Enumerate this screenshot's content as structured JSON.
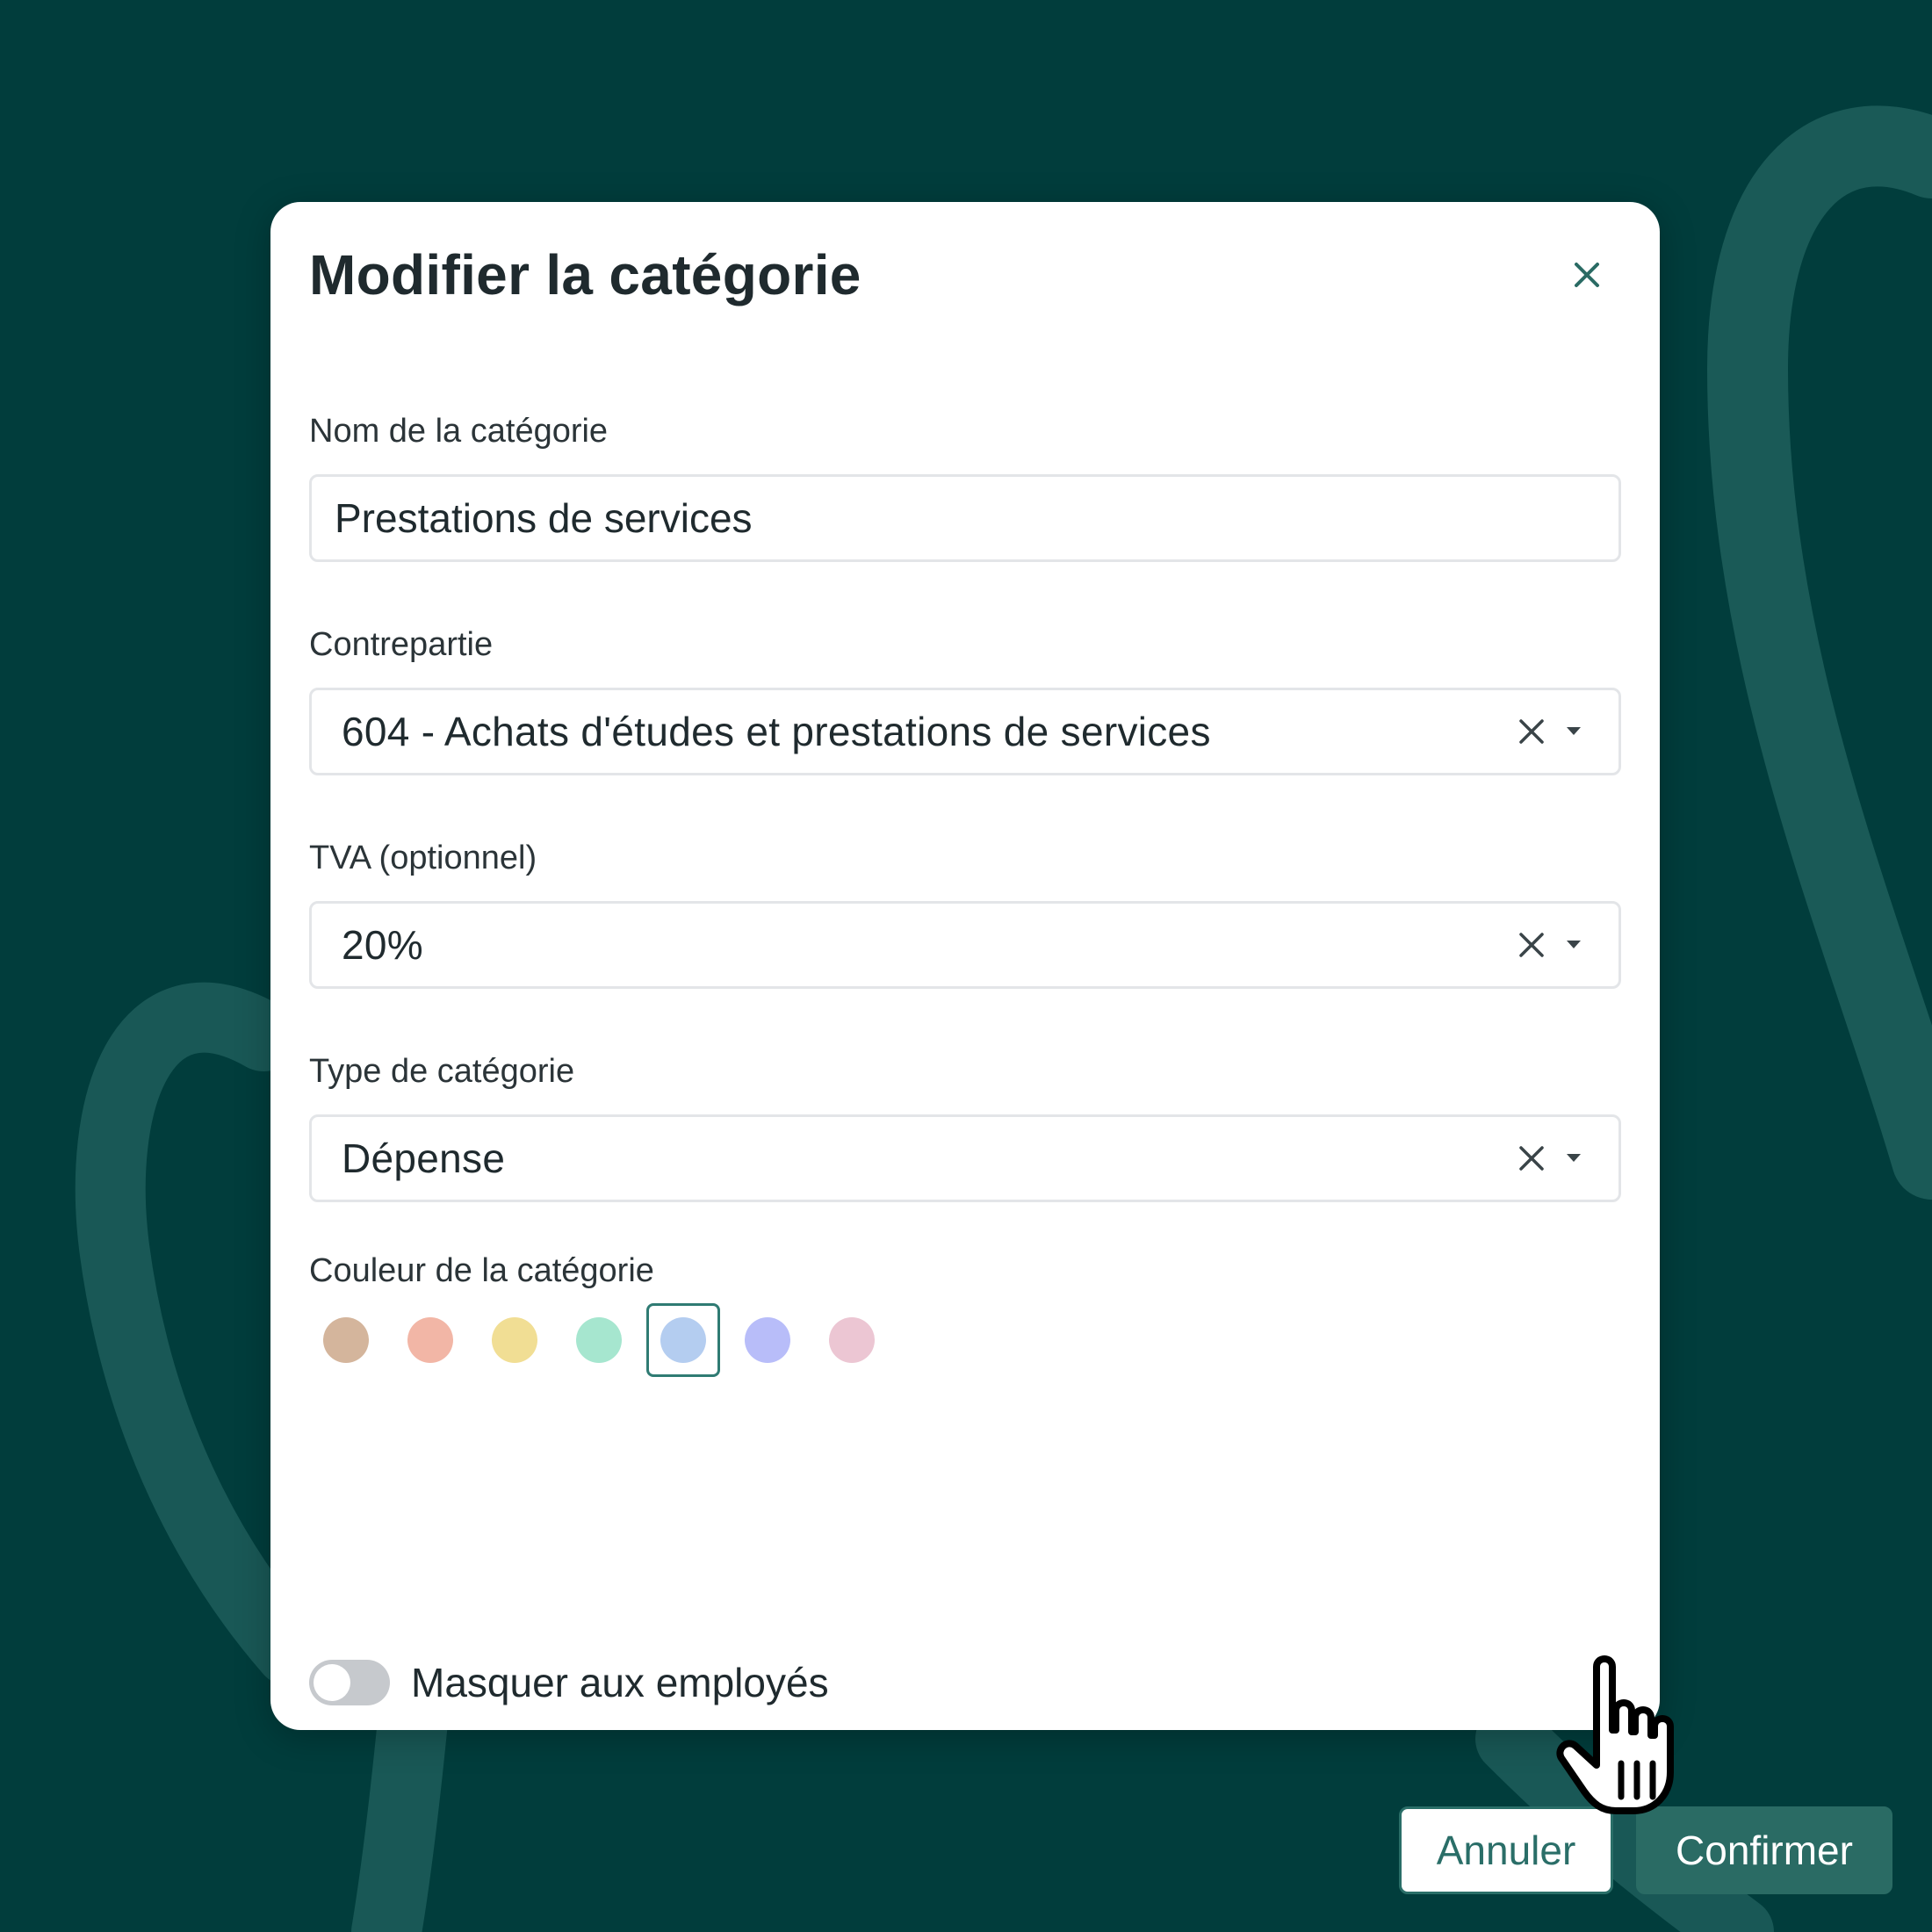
{
  "dialog": {
    "title": "Modifier la catégorie",
    "close_icon": "close-icon"
  },
  "fields": {
    "name": {
      "label": "Nom de la catégorie",
      "value": "Prestations de services"
    },
    "counterpart": {
      "label": "Contrepartie",
      "value": "604 - Achats d'études et prestations de services"
    },
    "vat": {
      "label": "TVA (optionnel)",
      "value": "20%"
    },
    "type": {
      "label": "Type de catégorie",
      "value": "Dépense"
    }
  },
  "color_picker": {
    "label": "Couleur de la catégorie",
    "swatches": [
      "#d4b59c",
      "#f2b6a6",
      "#f1de94",
      "#a6e6cf",
      "#b4cdf0",
      "#b8bdf9",
      "#ecc6d3"
    ],
    "selected_index": 4,
    "selected_border": "#2f7b73"
  },
  "toggle": {
    "label": "Masquer aux employés",
    "on": false
  },
  "buttons": {
    "cancel": "Annuler",
    "confirm": "Confirmer"
  },
  "colors": {
    "background": "#013d3c",
    "primary": "#2a6b64"
  }
}
